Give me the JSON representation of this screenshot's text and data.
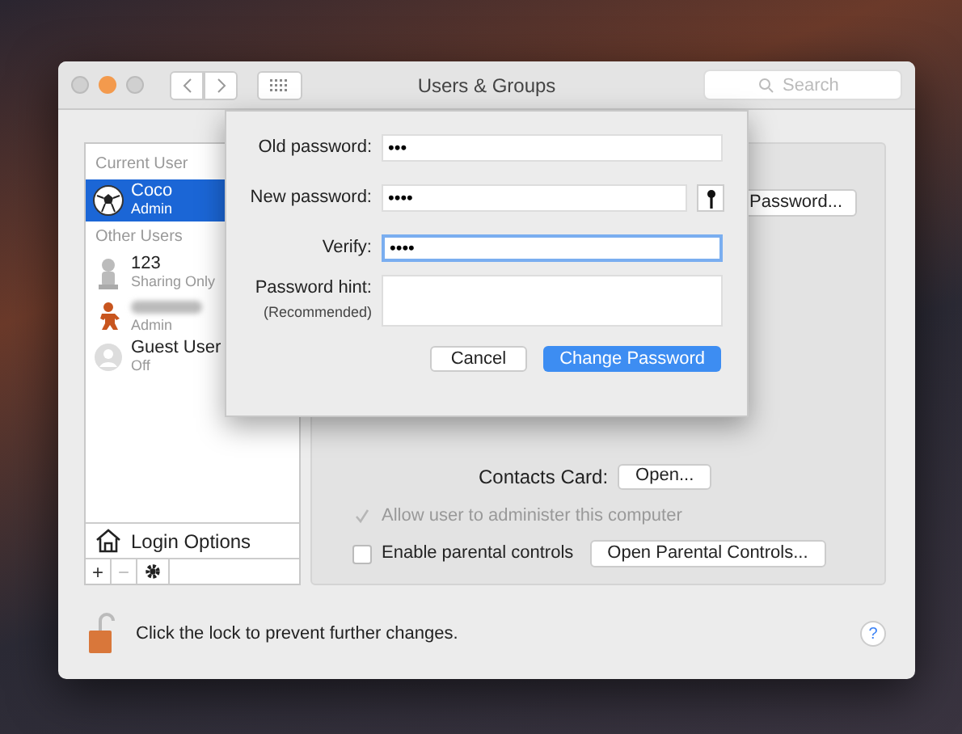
{
  "window": {
    "title": "Users & Groups",
    "search": {
      "placeholder": "Search"
    }
  },
  "sidebar": {
    "sections": [
      {
        "header": "Current User",
        "items": [
          {
            "name": "Coco",
            "role": "Admin",
            "kind": "ball",
            "selected": true
          }
        ]
      },
      {
        "header": "Other Users",
        "items": [
          {
            "name": "123",
            "role": "Sharing Only",
            "kind": "silhouette",
            "selected": false
          },
          {
            "role": "Admin",
            "kind": "figure",
            "selected": false
          },
          {
            "name": "Guest User",
            "role": "Off",
            "kind": "guest",
            "selected": false
          }
        ]
      }
    ],
    "login_options": "Login Options",
    "toolbar": [
      "+",
      "−"
    ]
  },
  "panel": {
    "password_button": "Password...",
    "contacts_label": "Contacts Card:",
    "contacts_button": "Open...",
    "checkboxes": [
      {
        "label": "Allow user to administer this computer",
        "checked": true,
        "disabled": true
      },
      {
        "label": "Enable parental controls",
        "checked": false,
        "disabled": false,
        "button": "Open Parental Controls..."
      }
    ]
  },
  "sheet": {
    "fields": [
      {
        "label": "Old password:",
        "value": "•••",
        "focused": false,
        "kind": "line"
      },
      {
        "label": "New password:",
        "value": "••••",
        "focused": false,
        "kind": "line_key"
      },
      {
        "label": "Verify:",
        "value": "••••",
        "focused": true,
        "kind": "line"
      },
      {
        "label": "Password hint:",
        "sublabel": "(Recommended)",
        "kind": "area"
      }
    ],
    "buttons": [
      {
        "label": "Cancel",
        "default": false
      },
      {
        "label": "Change Password",
        "default": true
      }
    ]
  },
  "footer": {
    "lock_text": "Click the lock to prevent further changes.",
    "help": "?"
  }
}
